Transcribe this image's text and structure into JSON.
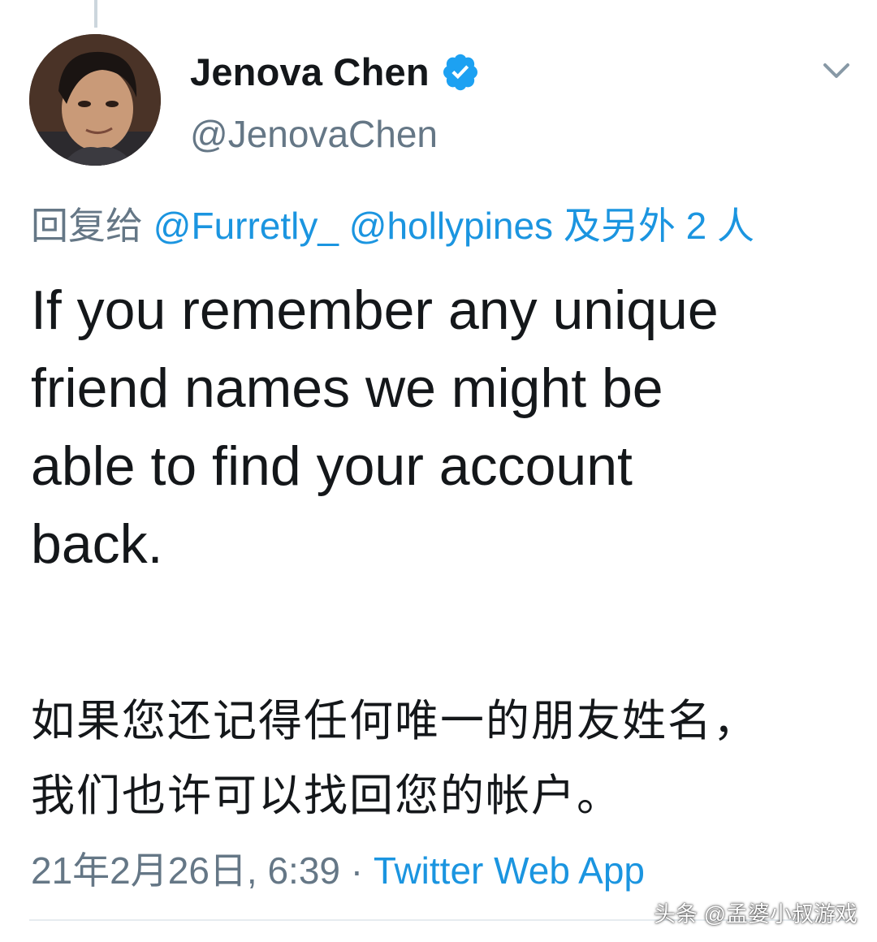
{
  "tweet": {
    "author": {
      "display_name": "Jenova Chen",
      "handle": "@JenovaChen",
      "verified": true,
      "avatar_icon": "profile-photo"
    },
    "reply_to": {
      "prefix": "回复给",
      "mention_1": "@Furretly_",
      "mention_2": "@hollypines",
      "others": "及另外 2 人"
    },
    "text_en": "If you remember any unique\nfriend names we might be\nable to find your account\nback.",
    "text_cn": "如果您还记得任何唯一的朋友姓名，\n我们也许可以找回您的帐户。",
    "timestamp": "21年2月26日, 6:39",
    "separator": "·",
    "source": "Twitter Web App"
  },
  "watermark": "头条 @孟婆小叔游戏",
  "icons": {
    "verified": "verified-badge-icon",
    "menu": "chevron-down-icon"
  },
  "colors": {
    "text": "#14171a",
    "secondary": "#657786",
    "link": "#1b95e0",
    "verified": "#1da1f2"
  }
}
